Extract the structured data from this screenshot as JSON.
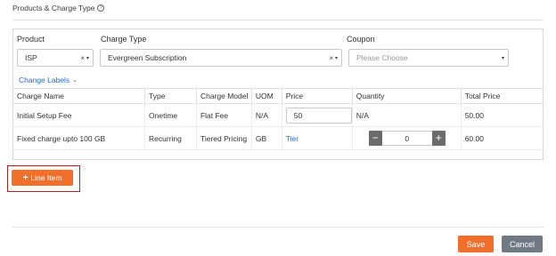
{
  "section": {
    "title": "Products & Charge Type"
  },
  "product": {
    "label": "Product",
    "value": "ISP"
  },
  "charge_type": {
    "label": "Charge Type",
    "value": "Evergreen Subscription"
  },
  "coupon": {
    "label": "Coupon",
    "placeholder": "Please Choose"
  },
  "glyphs": {
    "clear": "×",
    "caret": "▾",
    "chevron": "⌄",
    "plus": "+",
    "minus": "−"
  },
  "change_labels": "Change Labels",
  "table": {
    "headers": [
      "Charge Name",
      "Type",
      "Charge Model",
      "UOM",
      "Price",
      "Quantity",
      "Total Price"
    ],
    "rows": [
      {
        "name": "Initial Setup Fee",
        "type": "Onetime",
        "model": "Flat Fee",
        "uom": "N/A",
        "price": "50",
        "quantity": "N/A",
        "total": "50.00"
      },
      {
        "name": "Fixed charge upto 100 GB",
        "type": "Recurring",
        "model": "Tiered Pricing",
        "uom": "GB",
        "price_link": "Tier",
        "quantity": "0",
        "total": "60.00"
      }
    ]
  },
  "line_item_button": "Line Item",
  "footer": {
    "save": "Save",
    "cancel": "Cancel"
  },
  "colors": {
    "accent": "#f26f2b",
    "link": "#2a6ebb",
    "cancel": "#707a85",
    "highlight": "#b32020"
  }
}
